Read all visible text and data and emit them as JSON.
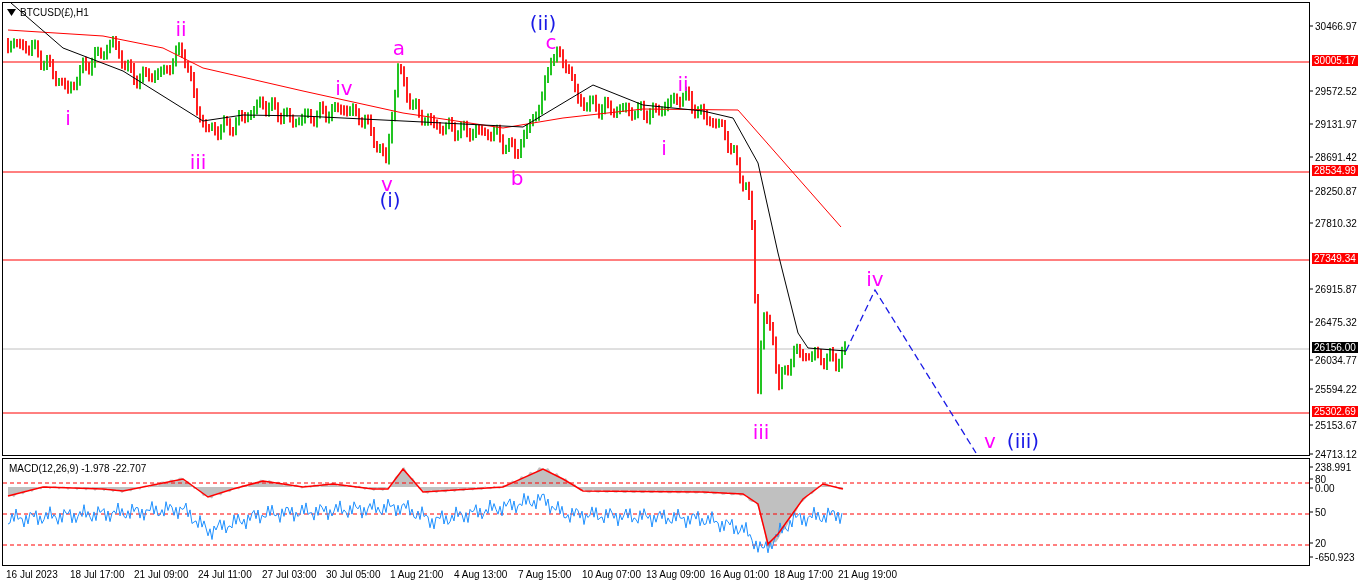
{
  "chart_title": "BTCUSD(£),H1",
  "price_axis": {
    "ticks": [
      "30466.97",
      "29572.52",
      "29131.97",
      "28691.42",
      "28250.87",
      "27810.32",
      "26915.87",
      "26475.32",
      "26034.77",
      "25594.22",
      "25153.67",
      "24713.12"
    ],
    "levels": [
      {
        "label": "30005.17",
        "kind": "line"
      },
      {
        "label": "28534.99",
        "kind": "line"
      },
      {
        "label": "27349.34",
        "kind": "line"
      },
      {
        "label": "26156.00",
        "kind": "current"
      },
      {
        "label": "25302.69",
        "kind": "line"
      }
    ]
  },
  "wave_labels": [
    {
      "text": "i",
      "color": "#ff00ff"
    },
    {
      "text": "ii",
      "color": "#ff00ff"
    },
    {
      "text": "iii",
      "color": "#ff00ff"
    },
    {
      "text": "iv",
      "color": "#ff00ff"
    },
    {
      "text": "v",
      "color": "#ff00ff"
    },
    {
      "text": "(i)",
      "color": "#1a1ae6"
    },
    {
      "text": "a",
      "color": "#ff00ff"
    },
    {
      "text": "b",
      "color": "#ff00ff"
    },
    {
      "text": "(ii)",
      "color": "#1a1ae6"
    },
    {
      "text": "c",
      "color": "#ff00ff"
    },
    {
      "text": "ii",
      "color": "#ff00ff"
    },
    {
      "text": "i",
      "color": "#ff00ff"
    },
    {
      "text": "iii",
      "color": "#ff00ff"
    },
    {
      "text": "iv",
      "color": "#ff00ff"
    },
    {
      "text": "v",
      "color": "#ff00ff"
    },
    {
      "text": "(iii)",
      "color": "#1a1ae6"
    }
  ],
  "indicator": {
    "title": "MACD(12,26,9) -1.978 -22.707",
    "axis": [
      "238.991",
      "80",
      "0.00",
      "50",
      "20",
      "-650.923"
    ]
  },
  "time_axis": [
    "16 Jul 2023",
    "18 Jul 17:00",
    "21 Jul 09:00",
    "24 Jul 11:00",
    "27 Jul 03:00",
    "30 Jul 05:00",
    "1 Aug 21:00",
    "4 Aug 13:00",
    "7 Aug 15:00",
    "10 Aug 07:00",
    "13 Aug 09:00",
    "16 Aug 01:00",
    "18 Aug 17:00",
    "21 Aug 19:00"
  ]
}
